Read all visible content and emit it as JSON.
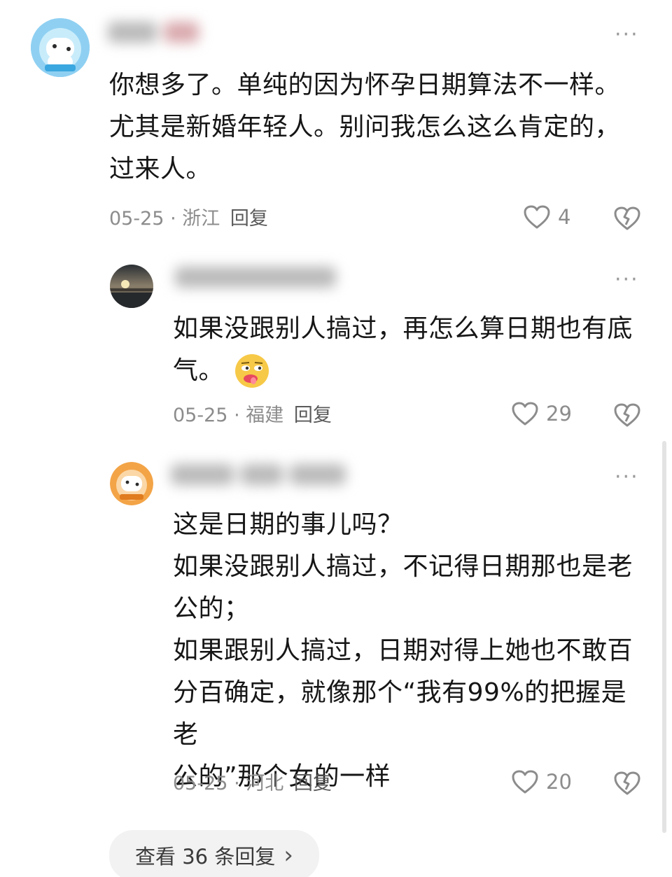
{
  "comments": [
    {
      "text_lines": [
        "你想多了。单纯的因为怀孕日期算法不一样。",
        "尤其是新婚年轻人。别问我怎么这么肯定的，",
        "过来人。"
      ],
      "date": "05-25",
      "location": "浙江",
      "reply_label": "回复",
      "likes": "4"
    },
    {
      "text_lines": [
        "如果没跟别人搞过，再怎么算日期也有底",
        "气。"
      ],
      "date": "05-25",
      "location": "福建",
      "reply_label": "回复",
      "likes": "29"
    },
    {
      "text_lines": [
        "这是日期的事儿吗？",
        "如果没跟别人搞过，不记得日期那也是老",
        "公的；",
        "如果跟别人搞过，日期对得上她也不敢百",
        "分百确定，就像那个“我有99%的把握是老",
        "公的”那个女的一样"
      ],
      "date": "05-25",
      "location": "河北",
      "reply_label": "回复",
      "likes": "20"
    }
  ],
  "meta_separator": "·",
  "more_glyph": "···",
  "view_more": {
    "label": "查看 36 条回复",
    "chevron": "›"
  },
  "icons": {
    "like": "heart-outline-icon",
    "dislike": "broken-heart-icon",
    "more": "more-dots-icon",
    "emoji": "drooling-emoji-icon"
  },
  "colors": {
    "text": "#161616",
    "meta": "#8c8c8c",
    "icon": "#8c8c8c",
    "pill_bg": "#f2f2f2"
  }
}
